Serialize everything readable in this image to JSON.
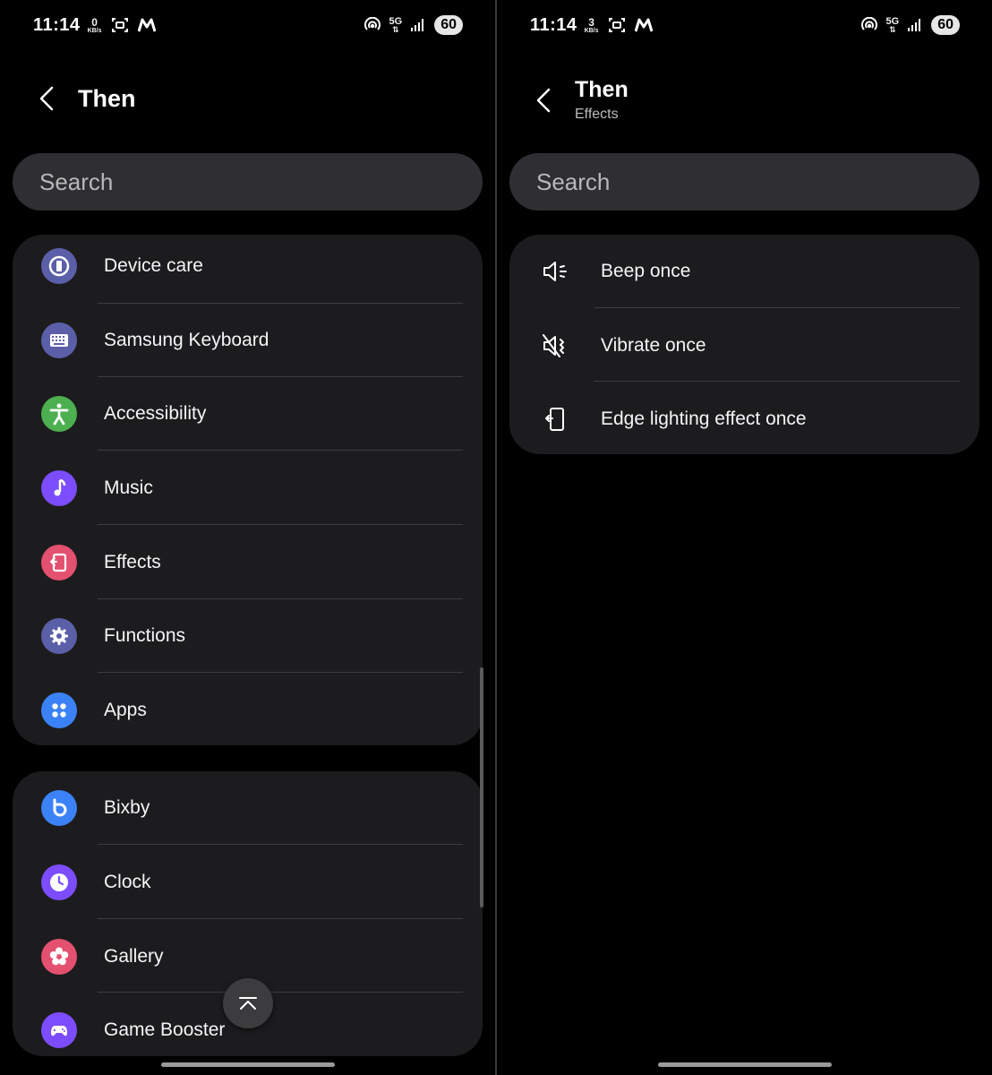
{
  "left": {
    "status": {
      "time": "11:14",
      "speed_value": "0",
      "speed_unit": "KB/s",
      "network": "5G",
      "battery": "60"
    },
    "header": {
      "title": "Then"
    },
    "search": {
      "placeholder": "Search"
    },
    "card1": {
      "items": [
        {
          "label": "Device care",
          "icon": "device-care-icon",
          "color": "#5b5fa8"
        },
        {
          "label": "Samsung Keyboard",
          "icon": "keyboard-icon",
          "color": "#5b5fa8"
        },
        {
          "label": "Accessibility",
          "icon": "accessibility-icon",
          "color": "#4caf50"
        },
        {
          "label": "Music",
          "icon": "music-note-icon",
          "color": "#7c4dff"
        },
        {
          "label": "Effects",
          "icon": "effects-icon",
          "color": "#e4506f"
        },
        {
          "label": "Functions",
          "icon": "gear-icon",
          "color": "#5b5fa8"
        },
        {
          "label": "Apps",
          "icon": "apps-grid-icon",
          "color": "#3b82f6"
        }
      ]
    },
    "card2": {
      "items": [
        {
          "label": "Bixby",
          "icon": "bixby-icon",
          "color": "#3b82f6"
        },
        {
          "label": "Clock",
          "icon": "clock-icon",
          "color": "#7c4dff"
        },
        {
          "label": "Gallery",
          "icon": "flower-icon",
          "color": "#e4506f"
        },
        {
          "label": "Game Booster",
          "icon": "gamepad-icon",
          "color": "#7c4dff"
        }
      ]
    }
  },
  "right": {
    "status": {
      "time": "11:14",
      "speed_value": "3",
      "speed_unit": "KB/s",
      "network": "5G",
      "battery": "60"
    },
    "header": {
      "title": "Then",
      "subtitle": "Effects"
    },
    "search": {
      "placeholder": "Search"
    },
    "card": {
      "items": [
        {
          "label": "Beep once",
          "icon": "speaker-icon"
        },
        {
          "label": "Vibrate once",
          "icon": "vibrate-icon"
        },
        {
          "label": "Edge lighting effect once",
          "icon": "edge-lighting-icon"
        }
      ]
    }
  }
}
